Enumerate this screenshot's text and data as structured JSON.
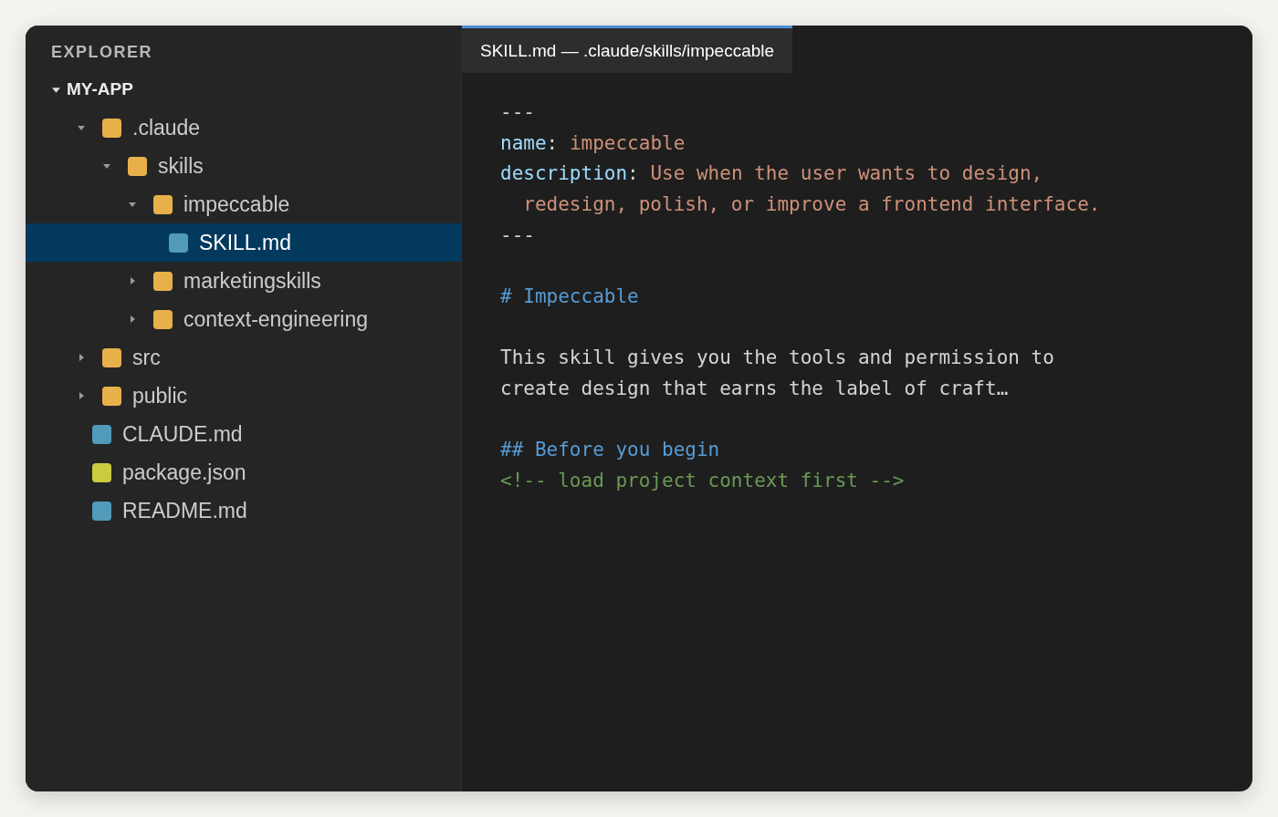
{
  "sidebar": {
    "title": "EXPLORER",
    "root": {
      "label": "MY-APP",
      "expanded": true
    },
    "items": [
      {
        "kind": "folder",
        "label": ".claude",
        "color": "#e8b04b",
        "expanded": true,
        "selected": false,
        "children": [
          {
            "kind": "folder",
            "label": "skills",
            "color": "#e8b04b",
            "expanded": true,
            "selected": false,
            "children": [
              {
                "kind": "folder",
                "label": "impeccable",
                "color": "#e8b04b",
                "expanded": true,
                "selected": false,
                "children": [
                  {
                    "kind": "file",
                    "label": "SKILL.md",
                    "color": "#519aba",
                    "selected": true
                  }
                ]
              },
              {
                "kind": "folder",
                "label": "marketingskills",
                "color": "#e8b04b",
                "expanded": false,
                "selected": false
              },
              {
                "kind": "folder",
                "label": "context-engineering",
                "color": "#e8b04b",
                "expanded": false,
                "selected": false
              }
            ]
          }
        ]
      },
      {
        "kind": "folder",
        "label": "src",
        "color": "#e8b04b",
        "expanded": false,
        "selected": false
      },
      {
        "kind": "folder",
        "label": "public",
        "color": "#e8b04b",
        "expanded": false,
        "selected": false
      },
      {
        "kind": "file",
        "label": "CLAUDE.md",
        "color": "#519aba",
        "selected": false
      },
      {
        "kind": "file",
        "label": "package.json",
        "color": "#cbcb41",
        "selected": false
      },
      {
        "kind": "file",
        "label": "README.md",
        "color": "#519aba",
        "selected": false
      }
    ]
  },
  "tab": {
    "label": "SKILL.md — .claude/skills/impeccable",
    "selected": true
  },
  "editor": {
    "blocks": [
      {
        "lines": [
          {
            "segments": [
              {
                "kind": "rule",
                "text": "---"
              }
            ]
          },
          {
            "segments": [
              {
                "kind": "key",
                "text": "name"
              },
              {
                "kind": "punct",
                "text": ": "
              },
              {
                "kind": "value",
                "text": "impeccable"
              }
            ]
          },
          {
            "segments": [
              {
                "kind": "key",
                "text": "description"
              },
              {
                "kind": "punct",
                "text": ": "
              },
              {
                "kind": "value",
                "text": "Use when the user wants to design,"
              }
            ]
          },
          {
            "segments": [
              {
                "kind": "value",
                "text": "  redesign, polish, or improve a frontend interface."
              }
            ]
          },
          {
            "segments": [
              {
                "kind": "rule",
                "text": "---"
              }
            ]
          }
        ]
      },
      {
        "lines": [
          {
            "segments": [
              {
                "kind": "heading",
                "text": "# Impeccable"
              }
            ]
          }
        ]
      },
      {
        "lines": [
          {
            "segments": [
              {
                "kind": "text",
                "text": "This skill gives you the tools and permission to"
              }
            ]
          },
          {
            "segments": [
              {
                "kind": "text",
                "text": "create design that earns the label of craft…"
              }
            ]
          }
        ]
      },
      {
        "lines": [
          {
            "segments": [
              {
                "kind": "heading",
                "text": "## Before you begin"
              }
            ]
          },
          {
            "segments": [
              {
                "kind": "comment",
                "text": "<!-- load project context first -->"
              }
            ]
          }
        ]
      }
    ]
  }
}
